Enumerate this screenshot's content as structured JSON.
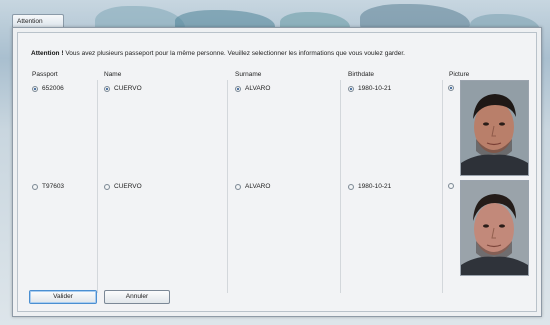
{
  "window": {
    "tab_label": "Attention"
  },
  "message": {
    "prefix": "Attention !",
    "text": "Vous avez plusieurs passeport pour la même personne. Veuillez selectionner les informations que vous voulez garder."
  },
  "columns": {
    "passport": "Passport",
    "name": "Name",
    "surname": "Surname",
    "birthdate": "Birthdate",
    "picture": "Picture"
  },
  "rows": [
    {
      "passport": "652006",
      "name": "CUERVO",
      "surname": "ALVARO",
      "birthdate": "1980-10-21",
      "selected": true
    },
    {
      "passport": "T97603",
      "name": "CUERVO",
      "surname": "ALVARO",
      "birthdate": "1980-10-21",
      "selected": false
    }
  ],
  "buttons": {
    "ok": "Valider",
    "cancel": "Annuler"
  }
}
